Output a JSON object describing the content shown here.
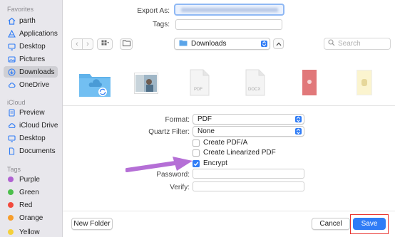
{
  "sidebar": {
    "favorites_header": "Favorites",
    "favorites": [
      {
        "label": "parth",
        "icon": "home-icon"
      },
      {
        "label": "Applications",
        "icon": "applications-icon"
      },
      {
        "label": "Desktop",
        "icon": "desktop-icon"
      },
      {
        "label": "Pictures",
        "icon": "pictures-icon"
      },
      {
        "label": "Downloads",
        "icon": "downloads-icon",
        "selected": true
      },
      {
        "label": "OneDrive",
        "icon": "cloud-icon"
      }
    ],
    "icloud_header": "iCloud",
    "icloud": [
      {
        "label": "Preview",
        "icon": "preview-icon"
      },
      {
        "label": "iCloud Drive",
        "icon": "icloud-drive-icon"
      },
      {
        "label": "Desktop",
        "icon": "desktop-icon"
      },
      {
        "label": "Documents",
        "icon": "document-icon"
      }
    ],
    "tags_header": "Tags",
    "tags": [
      {
        "label": "Purple",
        "color": "#b061d2"
      },
      {
        "label": "Green",
        "color": "#4cbf4c"
      },
      {
        "label": "Red",
        "color": "#f24a3d"
      },
      {
        "label": "Orange",
        "color": "#f79d2a"
      },
      {
        "label": "Yellow",
        "color": "#f4d03a"
      }
    ]
  },
  "export": {
    "export_as_label": "Export As:",
    "export_as_value": "",
    "tags_label": "Tags:",
    "tags_value": ""
  },
  "toolbar": {
    "location": "Downloads",
    "search_placeholder": "Search"
  },
  "files": [
    {
      "caption": "",
      "kind": "folder"
    },
    {
      "caption": "",
      "kind": "image"
    },
    {
      "caption": "PDF",
      "kind": "pdf"
    },
    {
      "caption": "DOCX",
      "kind": "docx"
    },
    {
      "caption": "",
      "kind": "thumb-red"
    },
    {
      "caption": "",
      "kind": "thumb-yellow"
    }
  ],
  "options": {
    "format_label": "Format:",
    "format_value": "PDF",
    "quartz_label": "Quartz Filter:",
    "quartz_value": "None",
    "create_pdfa": "Create PDF/A",
    "create_linearized": "Create Linearized PDF",
    "encrypt": "Encrypt",
    "encrypt_checked": true,
    "password_label": "Password:",
    "verify_label": "Verify:"
  },
  "footer": {
    "new_folder": "New Folder",
    "cancel": "Cancel",
    "save": "Save"
  },
  "colors": {
    "accent": "#2f7cf6",
    "annotation_arrow": "#b56fd6",
    "highlight_box": "#e8322d"
  }
}
